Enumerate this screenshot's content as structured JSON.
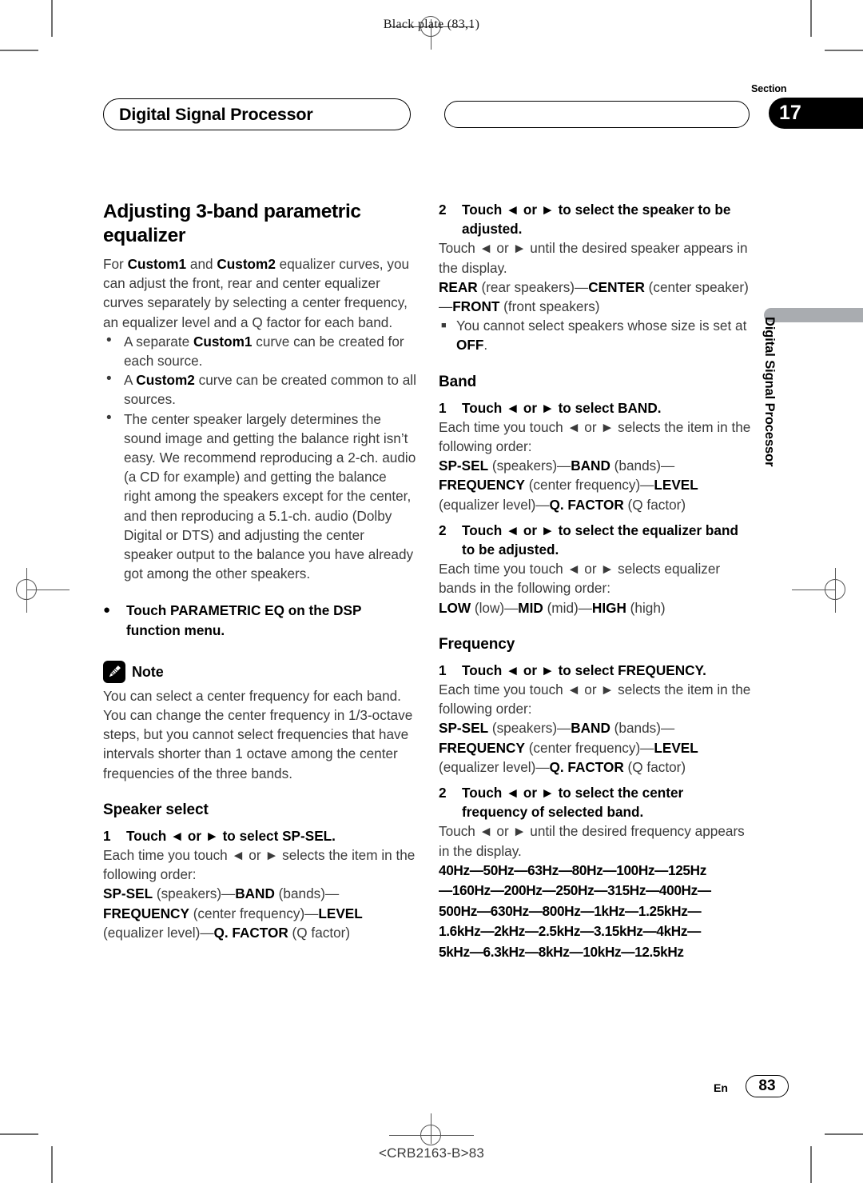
{
  "plate": {
    "label": "Black plate (83,1)"
  },
  "header": {
    "running_head": "Digital Signal Processor",
    "section_word": "Section",
    "section_number": "17"
  },
  "side_tab": {
    "text": "Digital Signal Processor"
  },
  "left_column": {
    "title": "Adjusting 3-band parametric equalizer",
    "intro_1": "For ",
    "intro_b1": "Custom1",
    "intro_2": " and ",
    "intro_b2": "Custom2",
    "intro_3": " equalizer curves, you can adjust the front, rear and center equalizer curves separately by selecting a center frequency, an equalizer level and a Q factor for each band.",
    "bullet1_a": "A separate ",
    "bullet1_b": "Custom1",
    "bullet1_c": " curve can be created for each source.",
    "bullet2_a": "A ",
    "bullet2_b": "Custom2",
    "bullet2_c": " curve can be created common to all sources.",
    "bullet3": "The center speaker largely determines the sound image and getting the balance right isn’t easy. We recommend reproducing a 2-ch. audio (a CD for example) and getting the balance right among the speakers except for the center, and then reproducing a 5.1-ch. audio (Dolby Digital or DTS) and adjusting the center speaker output to the balance you have already got among the other speakers.",
    "action": "Touch PARAMETRIC EQ on the DSP function menu.",
    "note_label": "Note",
    "note_body": "You can select a center frequency for each band. You can change the center frequency in 1/3-octave steps, but you cannot select frequencies that have intervals shorter than 1 octave among the center frequencies of the three bands.",
    "speaker_select_heading": "Speaker select",
    "sp_step1_num": "1",
    "sp_step1_text": "Touch ◄ or ► to select SP-SEL.",
    "sp_step1_body": "Each time you touch ◄ or ► selects the item in the following order:",
    "order_sp_sel": "SP-SEL",
    "order_speakers": " (speakers)—",
    "order_band": "BAND",
    "order_bands": " (bands)—",
    "order_frequency": "FREQUENCY",
    "order_centerfreq": " (center frequency)—",
    "order_level": "LEVEL",
    "order_eqlevel": " (equalizer level)—",
    "order_qfactor": "Q. FACTOR",
    "order_q": " (Q factor)"
  },
  "right_column": {
    "step2_num": "2",
    "step2_text": "Touch ◄ or ► to select the speaker to be adjusted.",
    "step2_body": "Touch ◄ or ► until the desired speaker appears in the display.",
    "speakers_rear": "REAR",
    "speakers_rear_p": " (rear speakers)—",
    "speakers_center": "CENTER",
    "speakers_center_p": " (center speaker)—",
    "speakers_front": "FRONT",
    "speakers_front_p": " (front speakers)",
    "speakers_note_a": "You cannot select speakers whose size is set at ",
    "speakers_note_b": "OFF",
    "speakers_note_c": ".",
    "band_heading": "Band",
    "band_step1_num": "1",
    "band_step1_text": "Touch ◄ or ► to select BAND.",
    "band_step1_body": "Each time you touch ◄ or ► selects the item in the following order:",
    "band_step2_num": "2",
    "band_step2_text": "Touch ◄ or ► to select the equalizer band to be adjusted.",
    "band_step2_body": "Each time you touch ◄ or ► selects equalizer bands in the following order:",
    "bands_low": "LOW",
    "bands_low_p": " (low)—",
    "bands_mid": "MID",
    "bands_mid_p": " (mid)—",
    "bands_high": "HIGH",
    "bands_high_p": " (high)",
    "frequency_heading": "Frequency",
    "freq_step1_num": "1",
    "freq_step1_text": "Touch ◄ or ► to select FREQUENCY.",
    "freq_step1_body": "Each time you touch ◄ or ► selects the item in the following order:",
    "freq_step2_num": "2",
    "freq_step2_text": "Touch ◄ or ► to select the center frequency of selected band.",
    "freq_step2_body": "Touch ◄ or ► until the desired frequency appears in the display.",
    "freq_line1": "40Hz—50Hz—63Hz—80Hz—100Hz—125Hz",
    "freq_line2": "—160Hz—200Hz—250Hz—315Hz—400Hz—",
    "freq_line3": "500Hz—630Hz—800Hz—1kHz—1.25kHz—",
    "freq_line4": "1.6kHz—2kHz—2.5kHz—3.15kHz—4kHz—",
    "freq_line5": "5kHz—6.3kHz—8kHz—10kHz—12.5kHz",
    "order_sp_sel": "SP-SEL",
    "order_speakers": " (speakers)—",
    "order_band": "BAND",
    "order_bands": " (bands)—",
    "order_frequency": "FREQUENCY",
    "order_centerfreq": " (center frequency)—",
    "order_level": "LEVEL",
    "order_eqlevel": " (equalizer level)—",
    "order_qfactor": "Q. FACTOR",
    "order_q": " (Q factor)"
  },
  "footer": {
    "language": "En",
    "page_number": "83",
    "code": "<CRB2163-B>83"
  }
}
